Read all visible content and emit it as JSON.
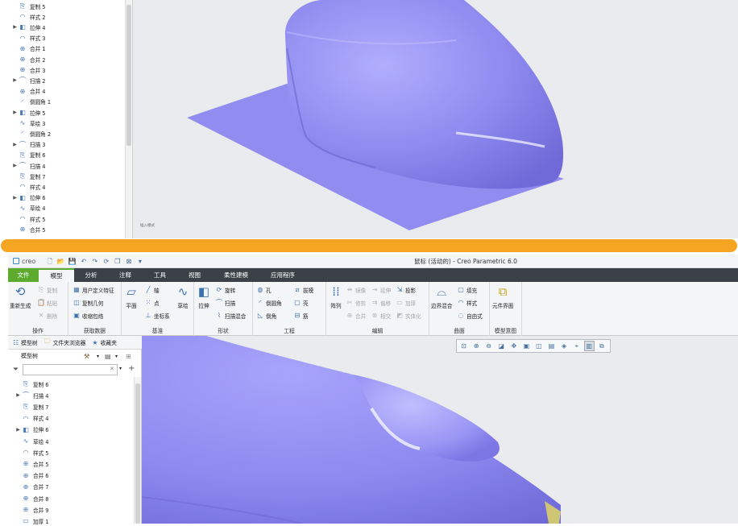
{
  "top_tree": {
    "items": [
      {
        "label": "复制 5",
        "icon": "copy-icon",
        "expandable": false
      },
      {
        "label": "样式 2",
        "icon": "style-icon",
        "expandable": false
      },
      {
        "label": "拉伸 4",
        "icon": "extrude-icon",
        "expandable": true
      },
      {
        "label": "样式 3",
        "icon": "style-icon",
        "expandable": false
      },
      {
        "label": "合并 1",
        "icon": "merge-icon",
        "expandable": false
      },
      {
        "label": "合并 2",
        "icon": "merge-icon",
        "expandable": false
      },
      {
        "label": "合并 3",
        "icon": "merge-icon",
        "expandable": false
      },
      {
        "label": "扫描 2",
        "icon": "sweep-icon",
        "expandable": true
      },
      {
        "label": "合并 4",
        "icon": "merge-icon",
        "expandable": false
      },
      {
        "label": "倒圆角 1",
        "icon": "round-icon",
        "expandable": false
      },
      {
        "label": "拉伸 5",
        "icon": "extrude-icon",
        "expandable": true
      },
      {
        "label": "草绘 3",
        "icon": "sketch-icon",
        "expandable": false
      },
      {
        "label": "倒圆角 2",
        "icon": "round-icon",
        "expandable": false
      },
      {
        "label": "扫描 3",
        "icon": "sweep-icon",
        "expandable": true
      },
      {
        "label": "复制 6",
        "icon": "copy-icon",
        "expandable": false
      },
      {
        "label": "扫描 4",
        "icon": "sweep-icon",
        "expandable": true
      },
      {
        "label": "复制 7",
        "icon": "copy-icon",
        "expandable": false
      },
      {
        "label": "样式 4",
        "icon": "style-icon",
        "expandable": false
      },
      {
        "label": "拉伸 6",
        "icon": "extrude-icon",
        "expandable": true
      },
      {
        "label": "草绘 4",
        "icon": "sketch-icon",
        "expandable": false
      },
      {
        "label": "样式 5",
        "icon": "style-icon",
        "expandable": false
      },
      {
        "label": "合并 5",
        "icon": "merge-icon",
        "expandable": false
      }
    ]
  },
  "top_viewport": {
    "status_text": "插入模式"
  },
  "app": {
    "logo_text": "creo",
    "window_title": "鼠标 (活动的) - Creo Parametric 6.0"
  },
  "ribbon_tabs": [
    {
      "label": "文件"
    },
    {
      "label": "模型"
    },
    {
      "label": "分析"
    },
    {
      "label": "注释"
    },
    {
      "label": "工具"
    },
    {
      "label": "视图"
    },
    {
      "label": "柔性建模"
    },
    {
      "label": "应用程序"
    }
  ],
  "ribbon": {
    "operations": {
      "label": "操作",
      "regenerate": "重新生成",
      "copy": "复制",
      "paste": "粘贴",
      "delete": "删除"
    },
    "get_data": {
      "label": "获取数据",
      "udf": "用户定义特征",
      "copy_geom": "复制几何",
      "shrinkwrap": "收缩包络"
    },
    "datum": {
      "label": "基准",
      "plane": "平面",
      "axis": "轴",
      "point": "点",
      "csys": "坐标系",
      "sketch": "草绘"
    },
    "shapes": {
      "label": "形状",
      "extrude": "拉伸",
      "revolve": "旋转",
      "sweep": "扫描",
      "swept_blend": "扫描混合"
    },
    "engineering": {
      "label": "工程",
      "hole": "孔",
      "draft": "拔模",
      "round": "倒圆角",
      "shell": "壳",
      "chamfer": "倒角",
      "rib": "筋"
    },
    "editing": {
      "label": "编辑",
      "pattern": "阵列",
      "mirror": "镜像",
      "extend": "延伸",
      "project": "投影",
      "trim": "修剪",
      "offset": "偏移",
      "thicken": "加厚",
      "merge": "合并",
      "intersect": "相交",
      "solidify": "实体化"
    },
    "surfaces": {
      "label": "曲面",
      "boundary_blend": "边界混合",
      "fill": "填充",
      "style": "样式",
      "freestyle": "自由式"
    },
    "model_intent": {
      "label": "模型意图",
      "component_interface": "元件界面"
    }
  },
  "tree_tabs": {
    "model_tree": "模型树",
    "folder_browser": "文件夹浏览器",
    "favorites": "收藏夹"
  },
  "tree": {
    "header": "模型树",
    "filter_placeholder": "",
    "items": [
      {
        "label": "复制 6",
        "icon": "copy-icon",
        "expandable": false
      },
      {
        "label": "扫描 4",
        "icon": "sweep-icon",
        "expandable": true
      },
      {
        "label": "复制 7",
        "icon": "copy-icon",
        "expandable": false
      },
      {
        "label": "样式 4",
        "icon": "style-icon",
        "expandable": false
      },
      {
        "label": "拉伸 6",
        "icon": "extrude-icon",
        "expandable": true
      },
      {
        "label": "草绘 4",
        "icon": "sketch-icon",
        "expandable": false
      },
      {
        "label": "样式 5",
        "icon": "style-icon",
        "expandable": false
      },
      {
        "label": "合并 5",
        "icon": "merge-icon",
        "expandable": false
      },
      {
        "label": "合并 6",
        "icon": "merge-icon",
        "expandable": false
      },
      {
        "label": "合并 7",
        "icon": "merge-icon",
        "expandable": false
      },
      {
        "label": "合并 8",
        "icon": "merge-icon",
        "expandable": false
      },
      {
        "label": "合并 9",
        "icon": "merge-icon",
        "expandable": false
      },
      {
        "label": "加厚 1",
        "icon": "thicken-icon",
        "expandable": false
      }
    ]
  },
  "view_toolbar": [
    "refit-icon",
    "zoom-in-icon",
    "zoom-out-icon",
    "repaint-icon",
    "spin-center-icon",
    "display-style-icon",
    "saved-views-icon",
    "view-manager-icon",
    "perspective-icon",
    "datum-display-icon",
    "annotation-display-icon",
    "section-icon"
  ],
  "colors": {
    "accent_orange": "#f6a523",
    "file_tab_green": "#5cab2f",
    "tab_bar_dark": "#3b4146",
    "model_purple": "#8f8bf0"
  }
}
